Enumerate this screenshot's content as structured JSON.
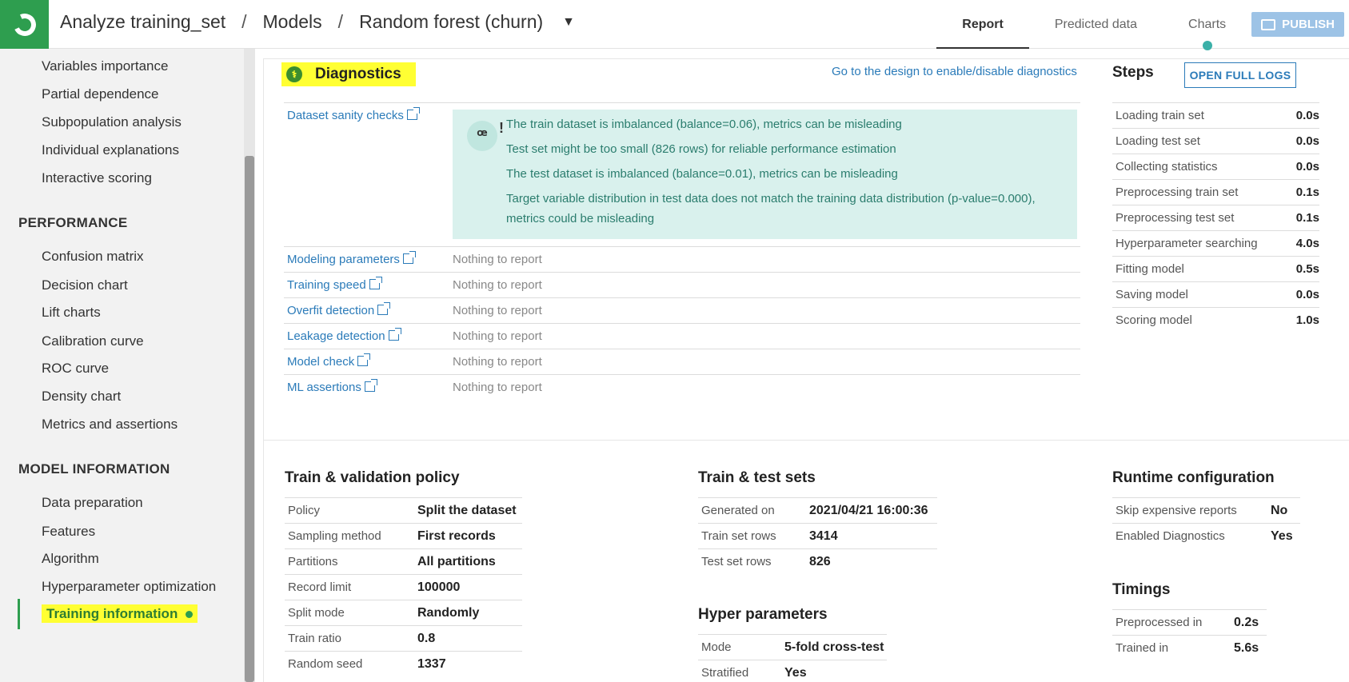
{
  "header": {
    "breadcrumb": [
      "Analyze training_set",
      "Models",
      "Random forest (churn)"
    ],
    "tabs": [
      "Report",
      "Predicted data",
      "Charts"
    ],
    "active_tab": "Report",
    "publish_label": "PUBLISH"
  },
  "sidebar": {
    "top_items": [
      "Variables importance",
      "Partial dependence",
      "Subpopulation analysis",
      "Individual explanations",
      "Interactive scoring"
    ],
    "performance_heading": "PERFORMANCE",
    "performance_items": [
      "Confusion matrix",
      "Decision chart",
      "Lift charts",
      "Calibration curve",
      "ROC curve",
      "Density chart",
      "Metrics and assertions"
    ],
    "model_info_heading": "MODEL INFORMATION",
    "model_info_items": [
      "Data preparation",
      "Features",
      "Algorithm",
      "Hyperparameter optimization"
    ],
    "active_item": "Training information"
  },
  "diagnostics": {
    "title": "Diagnostics",
    "design_link": "Go to the design to enable/disable diagnostics",
    "sanity_label": "Dataset sanity checks",
    "warnings": [
      "The train dataset is imbalanced (balance=0.06), metrics can be misleading",
      "Test set might be too small (826 rows) for reliable performance estimation",
      "The test dataset is imbalanced (balance=0.01), metrics can be misleading",
      "Target variable distribution in test data does not match the training data distribution (p-value=0.000),",
      "metrics could be misleading"
    ],
    "checks": [
      {
        "label": "Modeling parameters",
        "value": "Nothing to report"
      },
      {
        "label": "Training speed",
        "value": "Nothing to report"
      },
      {
        "label": "Overfit detection",
        "value": "Nothing to report"
      },
      {
        "label": "Leakage detection",
        "value": "Nothing to report"
      },
      {
        "label": "Model check",
        "value": "Nothing to report"
      },
      {
        "label": "ML assertions",
        "value": "Nothing to report"
      }
    ]
  },
  "steps": {
    "title": "Steps",
    "logs_button": "OPEN FULL LOGS",
    "rows": [
      {
        "k": "Loading train set",
        "v": "0.0s"
      },
      {
        "k": "Loading test set",
        "v": "0.0s"
      },
      {
        "k": "Collecting statistics",
        "v": "0.0s"
      },
      {
        "k": "Preprocessing train set",
        "v": "0.1s"
      },
      {
        "k": "Preprocessing test set",
        "v": "0.1s"
      },
      {
        "k": "Hyperparameter searching",
        "v": "4.0s"
      },
      {
        "k": "Fitting model",
        "v": "0.5s"
      },
      {
        "k": "Saving model",
        "v": "0.0s"
      },
      {
        "k": "Scoring model",
        "v": "1.0s"
      }
    ]
  },
  "train_policy": {
    "title": "Train & validation policy",
    "rows": [
      {
        "k": "Policy",
        "v": "Split the dataset"
      },
      {
        "k": "Sampling method",
        "v": "First records"
      },
      {
        "k": "Partitions",
        "v": "All partitions"
      },
      {
        "k": "Record limit",
        "v": "100000"
      },
      {
        "k": "Split mode",
        "v": "Randomly"
      },
      {
        "k": "Train ratio",
        "v": "0.8"
      },
      {
        "k": "Random seed",
        "v": "1337"
      }
    ]
  },
  "train_test": {
    "title": "Train & test sets",
    "rows": [
      {
        "k": "Generated on",
        "v": "2021/04/21 16:00:36"
      },
      {
        "k": "Train set rows",
        "v": "3414"
      },
      {
        "k": "Test set rows",
        "v": "826"
      }
    ]
  },
  "hyper": {
    "title": "Hyper parameters",
    "rows": [
      {
        "k": "Mode",
        "v": "5-fold cross-test"
      },
      {
        "k": "Stratified",
        "v": "Yes"
      }
    ]
  },
  "runtime": {
    "title": "Runtime configuration",
    "rows": [
      {
        "k": "Skip expensive reports",
        "v": "No"
      },
      {
        "k": "Enabled Diagnostics",
        "v": "Yes"
      }
    ]
  },
  "timings": {
    "title": "Timings",
    "rows": [
      {
        "k": "Preprocessed in",
        "v": "0.2s"
      },
      {
        "k": "Trained in",
        "v": "5.6s"
      }
    ]
  }
}
